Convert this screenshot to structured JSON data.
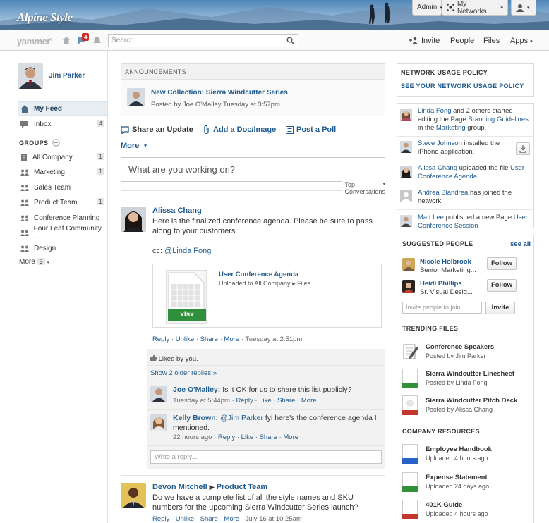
{
  "brand": {
    "name": "Alpine Style"
  },
  "topbar": {
    "admin": "Admin",
    "networks": "My Networks"
  },
  "nav": {
    "logo": "yammer",
    "notif_count": "4",
    "search_placeholder": "Search",
    "invite": "Invite",
    "people": "People",
    "files": "Files",
    "apps": "Apps"
  },
  "sidebar": {
    "user": "Jim Parker",
    "my_feed": "My Feed",
    "inbox": "Inbox",
    "inbox_count": "4",
    "groups_header": "GROUPS",
    "groups": [
      {
        "label": "All Company",
        "count": "1"
      },
      {
        "label": "Marketing",
        "count": "1"
      },
      {
        "label": "Sales Team",
        "count": ""
      },
      {
        "label": "Product Team",
        "count": "1"
      },
      {
        "label": "Conference Planning",
        "count": ""
      },
      {
        "label": "Four Leaf Community ...",
        "count": ""
      },
      {
        "label": "Design",
        "count": ""
      }
    ],
    "more": "More",
    "more_count": "3"
  },
  "announcements": {
    "header": "ANNOUNCEMENTS",
    "title": "New Collection: Sierra Windcutter Series",
    "meta": "Posted by Joe O'Malley Tuesday at 3:57pm"
  },
  "actions": {
    "share": "Share an Update",
    "doc": "Add a Doc/Image",
    "poll": "Post a Poll",
    "more": "More"
  },
  "composer": {
    "placeholder": "What are you working on?"
  },
  "feed": {
    "sort": "Top Conversations"
  },
  "post1": {
    "author": "Alissa Chang",
    "body": "Here is the finalized conference agenda. Please be sure to pass along to your customers.",
    "cc": "cc: ",
    "cc_user": "@Linda Fong",
    "attachment": {
      "title": "User Conference Agenda",
      "sub1": "Uploaded to All Company",
      "sub2": "Files",
      "ext": "xlsx"
    },
    "reply": "Reply",
    "unlike": "Unlike",
    "share": "Share",
    "more": "More",
    "time": "Tuesday at 2:51pm",
    "liked": "Liked by you.",
    "older": "Show 2 older replies »",
    "replies": [
      {
        "author": "Joe O'Malley:",
        "text": "Is it OK for us to share this list publicly?",
        "time": "Tuesday at 5:44pm"
      },
      {
        "author": "Kelly Brown:",
        "mention": "@Jim Parker",
        "text": " fyi here's the conference agenda I mentioned.",
        "time": "22 hours ago"
      }
    ],
    "reply_placeholder": "Write a reply..."
  },
  "reply_links": {
    "reply": "Reply",
    "like": "Like",
    "share": "Share",
    "more": "More"
  },
  "post2": {
    "author": "Devon Mitchell",
    "group": "Product Team",
    "body": "Do we have a complete list of all the style names and SKU numbers for the upcoming Sierra Windcutter Series launch?",
    "reply": "Reply",
    "unlike": "Unlike",
    "share": "Share",
    "more": "More",
    "time": "July 16 at 10:25am"
  },
  "policy": {
    "header": "NETWORK USAGE POLICY",
    "link": "SEE YOUR NETWORK USAGE POLICY"
  },
  "activity": [
    {
      "who": "Linda Fong",
      "a": " and 2 others started editing the Page ",
      "link": "Branding Guidelines",
      "b": " in the ",
      "link2": "Marketing",
      "c": " group."
    },
    {
      "who": "Steve Johnson",
      "a": " installed the iPhone application."
    },
    {
      "who": "Alissa Chang",
      "a": " uploaded the file ",
      "link": "User Conference Agenda",
      "b": "."
    },
    {
      "who": "Andrea Blandrea",
      "a": " has joined the network."
    },
    {
      "who": "Matt Lee",
      "a": " published a new Page ",
      "link": "User Conference Session"
    }
  ],
  "suggested": {
    "header": "SUGGESTED PEOPLE",
    "see_all": "see all",
    "people": [
      {
        "name": "Nicole Holbrook",
        "title": "Senior Marketing...",
        "btn": "Follow"
      },
      {
        "name": "Heidi Phillips",
        "title": "Sr. Visual Desig...",
        "btn": "Follow"
      }
    ],
    "invite_placeholder": "Invite people to join",
    "invite_btn": "Invite"
  },
  "trending": {
    "header": "TRENDING FILES",
    "files": [
      {
        "name": "Conference Speakers",
        "sub": "Posted by Jim Parker"
      },
      {
        "name": "Sierra Windcutter Linesheet",
        "sub": "Posted by Linda Fong"
      },
      {
        "name": "Sierra Windcutter Pitch Deck",
        "sub": "Posted by Alissa Chang"
      }
    ]
  },
  "resources": {
    "header": "COMPANY RESOURCES",
    "files": [
      {
        "name": "Employee Handbook",
        "sub": "Uploaded 4 hours ago"
      },
      {
        "name": "Expense Statement",
        "sub": "Uploaded 24 days ago"
      },
      {
        "name": "401K Guide",
        "sub": "Uploaded 4 hours ago"
      }
    ]
  },
  "colors": {
    "link": "#1e5a8e",
    "excel": "#2f8f3a",
    "word": "#2a62c9",
    "ppt": "#c0392b",
    "badge": "#c9302c"
  }
}
